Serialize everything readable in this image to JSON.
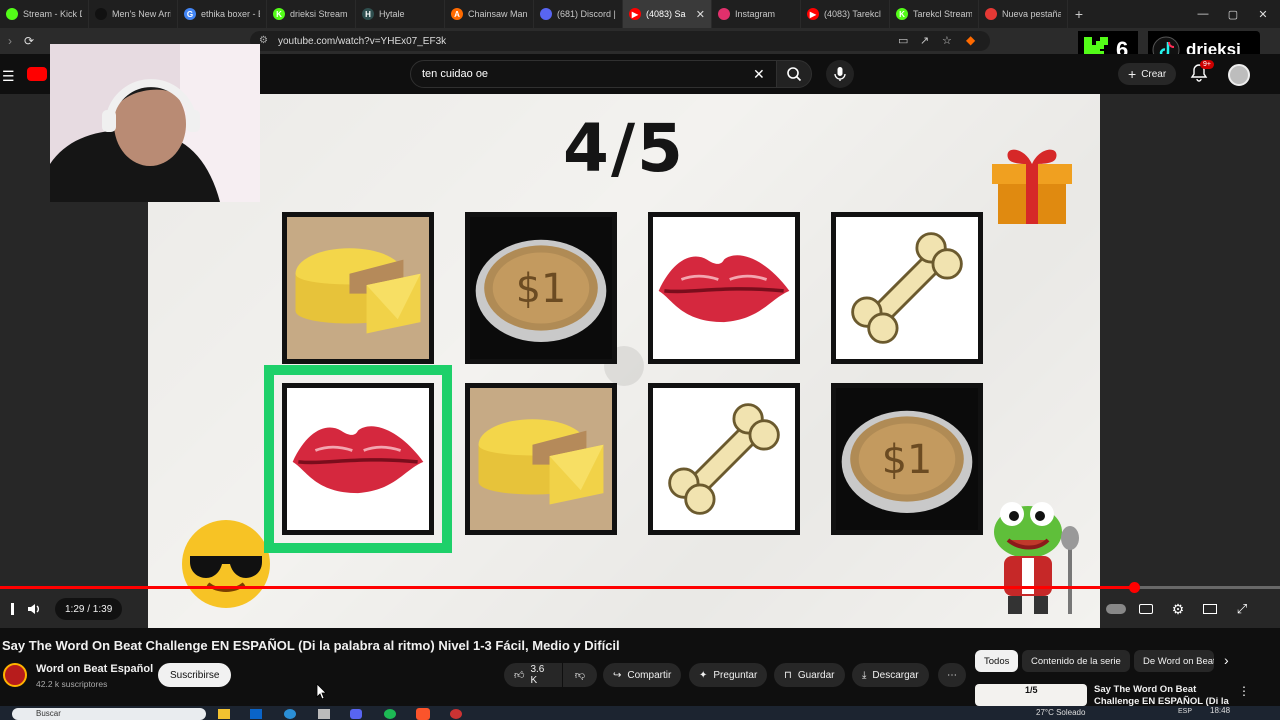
{
  "browser": {
    "tabs": [
      {
        "label": "Stream - Kick Da",
        "color": "#53fc18",
        "glyph": ""
      },
      {
        "label": "Men's New Arriv",
        "color": "#111111",
        "glyph": ""
      },
      {
        "label": "ethika boxer - Bu",
        "color": "#4285f4",
        "glyph": "G"
      },
      {
        "label": "drieksi Stream - ",
        "color": "#53fc18",
        "glyph": "K"
      },
      {
        "label": "Hytale",
        "color": "#2f4f4f",
        "glyph": "H"
      },
      {
        "label": "Chainsaw Man M",
        "color": "#ff6a00",
        "glyph": "A"
      },
      {
        "label": "(681) Discord | O",
        "color": "#5865f2",
        "glyph": ""
      },
      {
        "label": "(4083) Sa",
        "color": "#ff0000",
        "glyph": "▶"
      },
      {
        "label": "Instagram",
        "color": "#e1306c",
        "glyph": ""
      },
      {
        "label": "(4083) Tarekcl - ",
        "color": "#ff0000",
        "glyph": "▶"
      },
      {
        "label": "Tarekcl Stream - ",
        "color": "#53fc18",
        "glyph": "K"
      },
      {
        "label": "Nueva pestaña",
        "color": "#e53935",
        "glyph": ""
      }
    ],
    "active_tab_index": 7,
    "url": "youtube.com/watch?v=YHEx07_EF3k"
  },
  "overlay": {
    "kick_count": "6",
    "tiktok_name": "drieksi"
  },
  "youtube": {
    "search_query": "ten cuidao oe",
    "create_label": "Crear",
    "notif_badge": "9+"
  },
  "video": {
    "round_counter": "4/5",
    "grid": [
      [
        "cheese",
        "coin",
        "lips",
        "bone"
      ],
      [
        "lips",
        "cheese",
        "bone",
        "coin"
      ]
    ],
    "highlighted": [
      1,
      0
    ],
    "time_display": "1:29 / 1:39",
    "progress_fraction": 0.886
  },
  "meta": {
    "title": "Say The Word On Beat Challenge EN ESPAÑOL (Di la palabra al ritmo) Nivel 1-3 Fácil, Medio y Difícil",
    "channel": "Word on Beat Español",
    "subscribers": "42.2 k suscriptores",
    "subscribe_label": "Suscribirse",
    "likes": "3.6 K",
    "share_label": "Compartir",
    "ask_label": "Preguntar",
    "save_label": "Guardar",
    "download_label": "Descargar"
  },
  "sidebar": {
    "chips": [
      "Todos",
      "Contenido de la serie",
      "De Word on Beat"
    ],
    "rec_title": "Say The Word On Beat Challenge EN ESPAÑOL (Di la",
    "rec_thumb_counter": "1/5"
  },
  "taskbar": {
    "search_placeholder": "Buscar",
    "weather": "27°C Soleado",
    "lang": "ESP",
    "clock": "18:48"
  },
  "colors": {
    "accent_red": "#ff0000",
    "highlight_green": "#1ed06a",
    "kick_green": "#53fc18"
  }
}
